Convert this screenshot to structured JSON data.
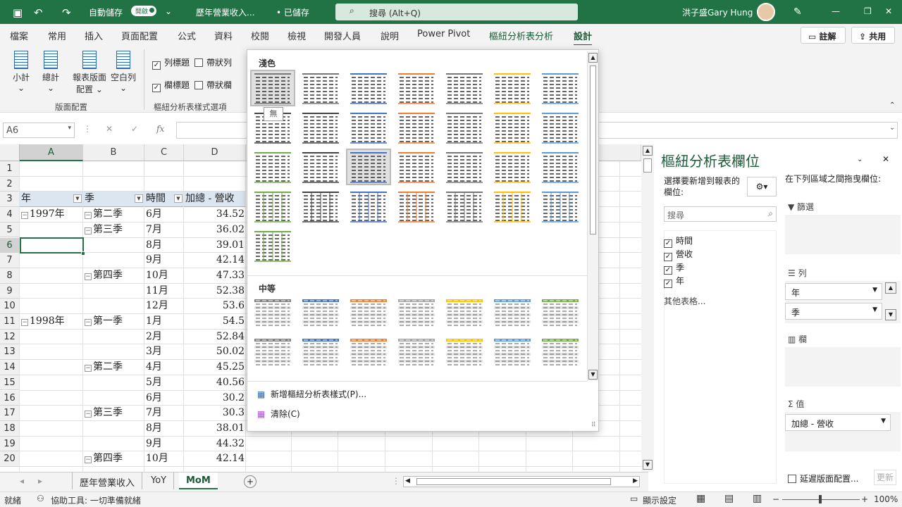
{
  "titlebar": {
    "autosave": "自動儲存",
    "toggle": "開啟",
    "filename": "歷年營業收入...",
    "saved": "• 已儲存",
    "search": "搜尋 (Alt+Q)",
    "user": "洪子盛Gary Hung"
  },
  "menu": [
    "檔案",
    "常用",
    "插入",
    "頁面配置",
    "公式",
    "資料",
    "校閱",
    "檢視",
    "開發人員",
    "說明",
    "Power Pivot",
    "樞紐分析表分析",
    "設計"
  ],
  "buttons": {
    "comments": "註解",
    "share": "共用"
  },
  "ribbon": {
    "subtotal": "小計",
    "grandtotal": "總計",
    "layout": "報表版面",
    "layout2": "配置",
    "blank": "空白列",
    "grp1": "版面配置",
    "grp2": "樞紐分析表樣式選項",
    "row_headers": "列標題",
    "col_headers": "欄標題",
    "banded_rows": "帶狀列",
    "banded_cols": "帶狀欄"
  },
  "namebox": "A6",
  "columns": [
    "A",
    "B",
    "C",
    "D"
  ],
  "rows": [
    {
      "n": "1",
      "a": "",
      "b": "",
      "c": "",
      "d": ""
    },
    {
      "n": "2",
      "a": "",
      "b": "",
      "c": "",
      "d": ""
    },
    {
      "n": "3",
      "a": "年",
      "b": "季",
      "c": "時間",
      "d": "加總 - 營收"
    },
    {
      "n": "4",
      "a": "1997年",
      "b": "第二季",
      "c": "6月",
      "d": "34.52"
    },
    {
      "n": "5",
      "a": "",
      "b": "第三季",
      "c": "7月",
      "d": "36.02"
    },
    {
      "n": "6",
      "a": "",
      "b": "",
      "c": "8月",
      "d": "39.01"
    },
    {
      "n": "7",
      "a": "",
      "b": "",
      "c": "9月",
      "d": "42.14"
    },
    {
      "n": "8",
      "a": "",
      "b": "第四季",
      "c": "10月",
      "d": "47.33"
    },
    {
      "n": "9",
      "a": "",
      "b": "",
      "c": "11月",
      "d": "52.38"
    },
    {
      "n": "10",
      "a": "",
      "b": "",
      "c": "12月",
      "d": "53.6"
    },
    {
      "n": "11",
      "a": "1998年",
      "b": "第一季",
      "c": "1月",
      "d": "54.5"
    },
    {
      "n": "12",
      "a": "",
      "b": "",
      "c": "2月",
      "d": "52.84"
    },
    {
      "n": "13",
      "a": "",
      "b": "",
      "c": "3月",
      "d": "50.02"
    },
    {
      "n": "14",
      "a": "",
      "b": "第二季",
      "c": "4月",
      "d": "45.25"
    },
    {
      "n": "15",
      "a": "",
      "b": "",
      "c": "5月",
      "d": "40.56"
    },
    {
      "n": "16",
      "a": "",
      "b": "",
      "c": "6月",
      "d": "30.2"
    },
    {
      "n": "17",
      "a": "",
      "b": "第三季",
      "c": "7月",
      "d": "30.3"
    },
    {
      "n": "18",
      "a": "",
      "b": "",
      "c": "8月",
      "d": "38.01"
    },
    {
      "n": "19",
      "a": "",
      "b": "",
      "c": "9月",
      "d": "44.32"
    },
    {
      "n": "20",
      "a": "",
      "b": "第四季",
      "c": "10月",
      "d": "42.14"
    }
  ],
  "gallery": {
    "light": "淺色",
    "medium": "中等",
    "tooltip": "無",
    "new_style": "新增樞紐分析表樣式(P)...",
    "clear": "清除(C)",
    "light_colors": [
      "#444444",
      "#444444",
      "#4472c4",
      "#ed7d31",
      "#777777",
      "#ffc000",
      "#5b9bd5",
      "#70ad47"
    ],
    "medium_colors": [
      "#7f7f7f",
      "#4472c4",
      "#ed7d31",
      "#a5a5a5",
      "#ffc000",
      "#5b9bd5",
      "#70ad47"
    ]
  },
  "pane": {
    "title": "樞紐分析表欄位",
    "choose": "選擇要新增到報表的欄位:",
    "drag": "在下列區域之間拖曳欄位:",
    "search": "搜尋",
    "fields": [
      "時間",
      "營收",
      "季",
      "年"
    ],
    "more": "其他表格...",
    "filters": "篩選",
    "rows": "列",
    "columns": "欄",
    "values": "值",
    "row_items": [
      "年",
      "季"
    ],
    "value_item": "加總 - 營收",
    "defer": "延遲版面配置...",
    "update": "更新"
  },
  "sheets": [
    "歷年營業收入",
    "YoY",
    "MoM"
  ],
  "status": {
    "ready": "就緒",
    "access": "協助工具: 一切準備就緒",
    "display": "顯示設定",
    "zoom": "100%"
  }
}
